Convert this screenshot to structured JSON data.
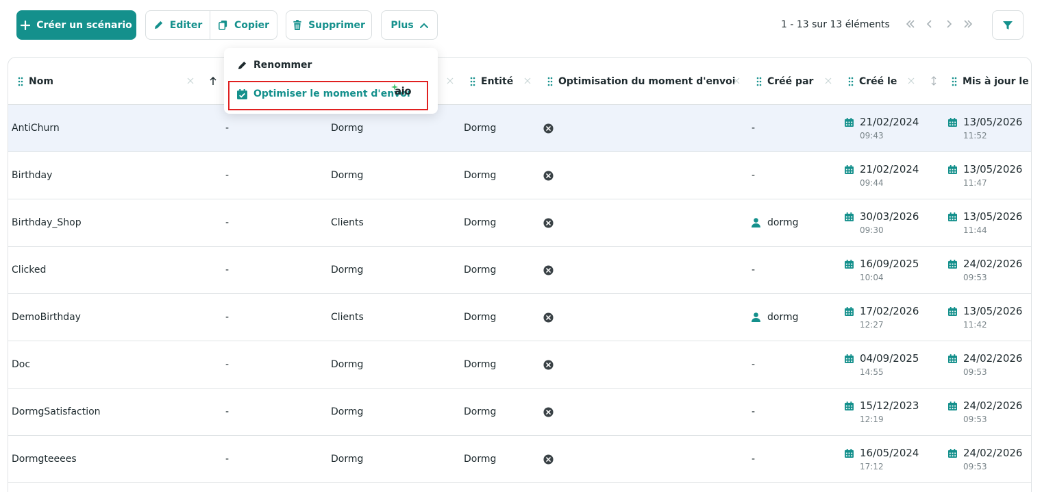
{
  "toolbar": {
    "create_label": "Créer un scénario",
    "edit_label": "Editer",
    "copy_label": "Copier",
    "delete_label": "Supprimer",
    "more_label": "Plus"
  },
  "pagination": {
    "summary": "1 - 13 sur 13 éléments"
  },
  "menu": {
    "rename_label": "Renommer",
    "optimize_label": "Optimiser le moment d'envoi",
    "badge": "aio"
  },
  "columns": {
    "name": "Nom",
    "entity": "Entité",
    "optimization": "Optimisation du moment d'envoi",
    "created_by": "Créé par",
    "created_on": "Créé le",
    "updated_on": "Mis à jour le"
  },
  "rows": [
    {
      "name": "AntiChurn",
      "col2": "-",
      "col3": "Dormg",
      "entity": "Dormg",
      "created_by": "-",
      "created_date": "21/02/2024",
      "created_time": "09:43",
      "updated_date": "13/05/2026",
      "updated_time": "11:52"
    },
    {
      "name": "Birthday",
      "col2": "-",
      "col3": "Dormg",
      "entity": "Dormg",
      "created_by": "-",
      "created_date": "21/02/2024",
      "created_time": "09:44",
      "updated_date": "13/05/2026",
      "updated_time": "11:47"
    },
    {
      "name": "Birthday_Shop",
      "col2": "-",
      "col3": "Clients",
      "entity": "Dormg",
      "created_by": "dormg",
      "created_date": "30/03/2026",
      "created_time": "09:30",
      "updated_date": "13/05/2026",
      "updated_time": "11:44"
    },
    {
      "name": "Clicked",
      "col2": "-",
      "col3": "Dormg",
      "entity": "Dormg",
      "created_by": "-",
      "created_date": "16/09/2025",
      "created_time": "10:04",
      "updated_date": "24/02/2026",
      "updated_time": "09:53"
    },
    {
      "name": "DemoBirthday",
      "col2": "-",
      "col3": "Clients",
      "entity": "Dormg",
      "created_by": "dormg",
      "created_date": "17/02/2026",
      "created_time": "12:27",
      "updated_date": "13/05/2026",
      "updated_time": "11:42"
    },
    {
      "name": "Doc",
      "col2": "-",
      "col3": "Dormg",
      "entity": "Dormg",
      "created_by": "-",
      "created_date": "04/09/2025",
      "created_time": "14:55",
      "updated_date": "24/02/2026",
      "updated_time": "09:53"
    },
    {
      "name": "DormgSatisfaction",
      "col2": "-",
      "col3": "Dormg",
      "entity": "Dormg",
      "created_by": "-",
      "created_date": "15/12/2023",
      "created_time": "12:19",
      "updated_date": "24/02/2026",
      "updated_time": "09:53"
    },
    {
      "name": "Dormgteeees",
      "col2": "-",
      "col3": "Dormg",
      "entity": "Dormg",
      "created_by": "-",
      "created_date": "16/05/2024",
      "created_time": "17:12",
      "updated_date": "24/02/2026",
      "updated_time": "09:53"
    }
  ],
  "colors": {
    "accent": "#14908c",
    "highlight_border": "#e02020",
    "selected_row": "#eef3fb"
  }
}
